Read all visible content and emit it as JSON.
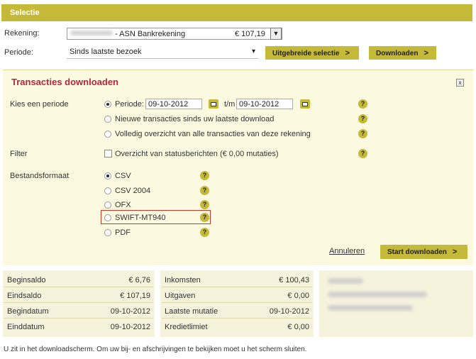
{
  "selectie": {
    "title": "Selectie"
  },
  "rekening": {
    "label": "Rekening:",
    "account_name": "- ASN Bankrekening",
    "balance": "€ 107,19"
  },
  "periode": {
    "label": "Periode:",
    "value": "Sinds laatste bezoek",
    "uitgebreide_btn": "Uitgebreide selectie",
    "downloaden_btn": "Downloaden"
  },
  "download_panel": {
    "title": "Transacties downloaden",
    "kies_label": "Kies een periode",
    "periode_opt": "Periode:",
    "date_from": "09-10-2012",
    "tm_label": "t/m",
    "date_to": "09-10-2012",
    "nieuwe_opt": "Nieuwe transacties sinds uw laatste download",
    "volledig_opt": "Volledig overzicht van alle transacties van deze rekening",
    "filter_label": "Filter",
    "filter_opt": "Overzicht van statusberichten (€ 0,00 mutaties)",
    "format_label": "Bestandsformaat",
    "formats": [
      "CSV",
      "CSV 2004",
      "OFX",
      "SWIFT-MT940",
      "PDF"
    ],
    "cancel": "Annuleren",
    "start": "Start downloaden"
  },
  "summary": {
    "left": [
      {
        "label": "Beginsaldo",
        "value": "€ 6,76"
      },
      {
        "label": "Eindsaldo",
        "value": "€ 107,19"
      },
      {
        "label": "Begindatum",
        "value": "09-10-2012"
      },
      {
        "label": "Einddatum",
        "value": "09-10-2012"
      }
    ],
    "middle": [
      {
        "label": "Inkomsten",
        "value": "€ 100,43"
      },
      {
        "label": "Uitgaven",
        "value": "€ 0,00"
      },
      {
        "label": "Laatste mutatie",
        "value": "09-10-2012"
      },
      {
        "label": "Kredietlimiet",
        "value": "€ 0,00"
      }
    ]
  },
  "footer": "U zit in het downloadscherm. Om uw bij- en afschrijvingen te bekijken moet u het scherm sluiten.",
  "colors": {
    "accent": "#c4b939",
    "title_red": "#b5273c",
    "panel_bg": "#fbf9e0"
  },
  "icons": {
    "help": "?",
    "close": "x",
    "chevron": "›",
    "dropdown": "▾"
  }
}
